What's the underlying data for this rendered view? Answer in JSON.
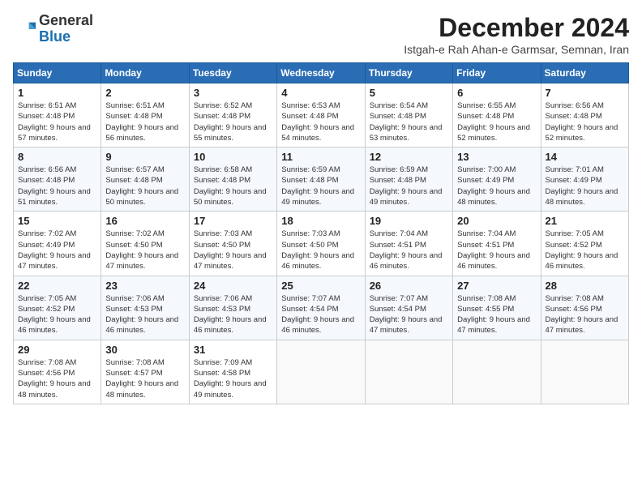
{
  "logo": {
    "general": "General",
    "blue": "Blue"
  },
  "title": "December 2024",
  "location": "Istgah-e Rah Ahan-e Garmsar, Semnan, Iran",
  "days_of_week": [
    "Sunday",
    "Monday",
    "Tuesday",
    "Wednesday",
    "Thursday",
    "Friday",
    "Saturday"
  ],
  "weeks": [
    [
      {
        "day": "1",
        "sunrise": "6:51 AM",
        "sunset": "4:48 PM",
        "daylight": "9 hours and 57 minutes."
      },
      {
        "day": "2",
        "sunrise": "6:51 AM",
        "sunset": "4:48 PM",
        "daylight": "9 hours and 56 minutes."
      },
      {
        "day": "3",
        "sunrise": "6:52 AM",
        "sunset": "4:48 PM",
        "daylight": "9 hours and 55 minutes."
      },
      {
        "day": "4",
        "sunrise": "6:53 AM",
        "sunset": "4:48 PM",
        "daylight": "9 hours and 54 minutes."
      },
      {
        "day": "5",
        "sunrise": "6:54 AM",
        "sunset": "4:48 PM",
        "daylight": "9 hours and 53 minutes."
      },
      {
        "day": "6",
        "sunrise": "6:55 AM",
        "sunset": "4:48 PM",
        "daylight": "9 hours and 52 minutes."
      },
      {
        "day": "7",
        "sunrise": "6:56 AM",
        "sunset": "4:48 PM",
        "daylight": "9 hours and 52 minutes."
      }
    ],
    [
      {
        "day": "8",
        "sunrise": "6:56 AM",
        "sunset": "4:48 PM",
        "daylight": "9 hours and 51 minutes."
      },
      {
        "day": "9",
        "sunrise": "6:57 AM",
        "sunset": "4:48 PM",
        "daylight": "9 hours and 50 minutes."
      },
      {
        "day": "10",
        "sunrise": "6:58 AM",
        "sunset": "4:48 PM",
        "daylight": "9 hours and 50 minutes."
      },
      {
        "day": "11",
        "sunrise": "6:59 AM",
        "sunset": "4:48 PM",
        "daylight": "9 hours and 49 minutes."
      },
      {
        "day": "12",
        "sunrise": "6:59 AM",
        "sunset": "4:48 PM",
        "daylight": "9 hours and 49 minutes."
      },
      {
        "day": "13",
        "sunrise": "7:00 AM",
        "sunset": "4:49 PM",
        "daylight": "9 hours and 48 minutes."
      },
      {
        "day": "14",
        "sunrise": "7:01 AM",
        "sunset": "4:49 PM",
        "daylight": "9 hours and 48 minutes."
      }
    ],
    [
      {
        "day": "15",
        "sunrise": "7:02 AM",
        "sunset": "4:49 PM",
        "daylight": "9 hours and 47 minutes."
      },
      {
        "day": "16",
        "sunrise": "7:02 AM",
        "sunset": "4:50 PM",
        "daylight": "9 hours and 47 minutes."
      },
      {
        "day": "17",
        "sunrise": "7:03 AM",
        "sunset": "4:50 PM",
        "daylight": "9 hours and 47 minutes."
      },
      {
        "day": "18",
        "sunrise": "7:03 AM",
        "sunset": "4:50 PM",
        "daylight": "9 hours and 46 minutes."
      },
      {
        "day": "19",
        "sunrise": "7:04 AM",
        "sunset": "4:51 PM",
        "daylight": "9 hours and 46 minutes."
      },
      {
        "day": "20",
        "sunrise": "7:04 AM",
        "sunset": "4:51 PM",
        "daylight": "9 hours and 46 minutes."
      },
      {
        "day": "21",
        "sunrise": "7:05 AM",
        "sunset": "4:52 PM",
        "daylight": "9 hours and 46 minutes."
      }
    ],
    [
      {
        "day": "22",
        "sunrise": "7:05 AM",
        "sunset": "4:52 PM",
        "daylight": "9 hours and 46 minutes."
      },
      {
        "day": "23",
        "sunrise": "7:06 AM",
        "sunset": "4:53 PM",
        "daylight": "9 hours and 46 minutes."
      },
      {
        "day": "24",
        "sunrise": "7:06 AM",
        "sunset": "4:53 PM",
        "daylight": "9 hours and 46 minutes."
      },
      {
        "day": "25",
        "sunrise": "7:07 AM",
        "sunset": "4:54 PM",
        "daylight": "9 hours and 46 minutes."
      },
      {
        "day": "26",
        "sunrise": "7:07 AM",
        "sunset": "4:54 PM",
        "daylight": "9 hours and 47 minutes."
      },
      {
        "day": "27",
        "sunrise": "7:08 AM",
        "sunset": "4:55 PM",
        "daylight": "9 hours and 47 minutes."
      },
      {
        "day": "28",
        "sunrise": "7:08 AM",
        "sunset": "4:56 PM",
        "daylight": "9 hours and 47 minutes."
      }
    ],
    [
      {
        "day": "29",
        "sunrise": "7:08 AM",
        "sunset": "4:56 PM",
        "daylight": "9 hours and 48 minutes."
      },
      {
        "day": "30",
        "sunrise": "7:08 AM",
        "sunset": "4:57 PM",
        "daylight": "9 hours and 48 minutes."
      },
      {
        "day": "31",
        "sunrise": "7:09 AM",
        "sunset": "4:58 PM",
        "daylight": "9 hours and 49 minutes."
      },
      null,
      null,
      null,
      null
    ]
  ]
}
